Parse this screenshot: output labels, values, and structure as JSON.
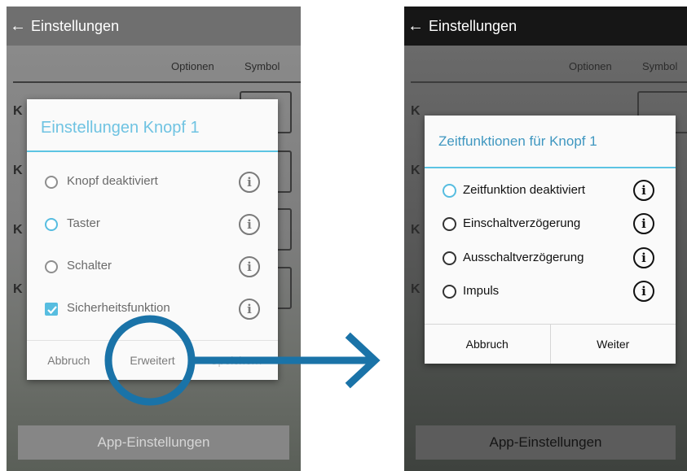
{
  "colors": {
    "accent": "#57bde0",
    "annotation": "#1a73a8"
  },
  "left": {
    "app_title": "Einstellungen",
    "col_options": "Optionen",
    "col_symbol": "Symbol",
    "row_initial": "K",
    "bottom_button": "App-Einstellungen",
    "dialog": {
      "title": "Einstellungen Knopf 1",
      "options": [
        {
          "label": "Knopf deaktiviert",
          "control": "radio",
          "selected": false
        },
        {
          "label": "Taster",
          "control": "radio",
          "selected": true
        },
        {
          "label": "Schalter",
          "control": "radio",
          "selected": false
        },
        {
          "label": "Sicherheitsfunktion",
          "control": "checkbox",
          "selected": true
        }
      ],
      "buttons": [
        "Abbruch",
        "Erweitert",
        "Speichern"
      ]
    }
  },
  "right": {
    "app_title": "Einstellungen",
    "col_options": "Optionen",
    "col_symbol": "Symbol",
    "row_initial": "K",
    "bottom_button": "App-Einstellungen",
    "dialog": {
      "title": "Zeitfunktionen für Knopf 1",
      "options": [
        {
          "label": "Zeitfunktion deaktiviert",
          "control": "radio",
          "selected": true
        },
        {
          "label": "Einschaltverzögerung",
          "control": "radio",
          "selected": false
        },
        {
          "label": "Ausschaltverzögerung",
          "control": "radio",
          "selected": false
        },
        {
          "label": "Impuls",
          "control": "radio",
          "selected": false
        }
      ],
      "buttons": [
        "Abbruch",
        "Weiter"
      ]
    }
  },
  "icons": {
    "back": "arrow-left-icon",
    "info": "info-circle-icon",
    "arrow": "arrow-right-icon"
  }
}
